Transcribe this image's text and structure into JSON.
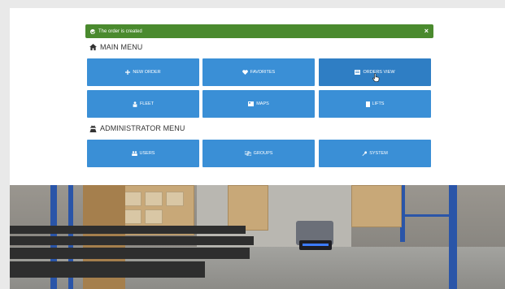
{
  "notification": {
    "message": "The order is created",
    "close_label": "×"
  },
  "main_menu": {
    "title": "MAIN MENU",
    "items": [
      {
        "label": "NEW ORDER",
        "icon": "plus-icon"
      },
      {
        "label": "FAVORITES",
        "icon": "heart-icon"
      },
      {
        "label": "ORDERS VIEW",
        "icon": "list-icon"
      },
      {
        "label": "FLEET",
        "icon": "robot-icon"
      },
      {
        "label": "MAPS",
        "icon": "map-icon"
      },
      {
        "label": "LIFTS",
        "icon": "lift-icon"
      }
    ]
  },
  "admin_menu": {
    "title": "ADMINISTRATOR MENU",
    "items": [
      {
        "label": "USERS",
        "icon": "users-icon"
      },
      {
        "label": "GROUPS",
        "icon": "groups-icon"
      },
      {
        "label": "SYSTEM",
        "icon": "wrench-icon"
      }
    ]
  },
  "colors": {
    "tile": "#3a8fd6",
    "tile_hover": "#2f7ec4",
    "success": "#4a8a2e"
  }
}
